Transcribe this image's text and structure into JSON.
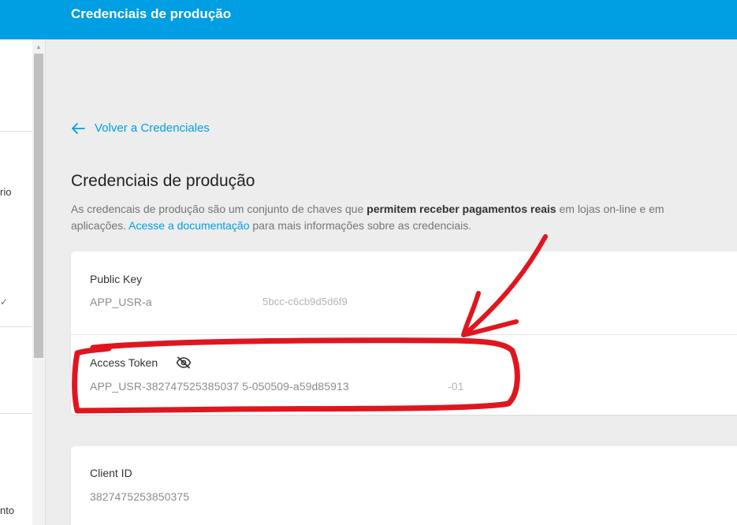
{
  "header": {
    "title": "Credenciais de produção"
  },
  "sidebar": {
    "fragments": [
      {
        "text": "rio"
      },
      {
        "text": "✓"
      },
      {
        "text": "nto"
      }
    ]
  },
  "back_link": {
    "label": "Volver a Credenciales"
  },
  "page": {
    "title": "Credenciais de produção",
    "desc_part1": "As credencais de produção são um conjunto de chaves que ",
    "desc_bold": "permitem receber pagamentos reais",
    "desc_part2": " em lojas on-line e em",
    "desc_line2_start": "aplicações. ",
    "desc_link": "Acesse a documentação",
    "desc_line2_end": " para mais informações sobre as credenciais."
  },
  "credentials": {
    "public_key": {
      "label": "Public Key",
      "value": "APP_USR-a"
    },
    "public_key_tail": {
      "value": "5bcc-c6cb9d5d6f9"
    },
    "access_token": {
      "label": "Access Token",
      "value": "APP_USR-382747525385037 5-050509-a59d85913"
    },
    "access_token_tail": {
      "value": "-01"
    },
    "client_id": {
      "label": "Client ID",
      "value": "3827475253850375"
    }
  },
  "icons": {
    "visibility": "eye-slash-icon",
    "back": "arrow-left-icon"
  },
  "colors": {
    "brand": "#009ee3",
    "annotation": "#e0161f"
  }
}
